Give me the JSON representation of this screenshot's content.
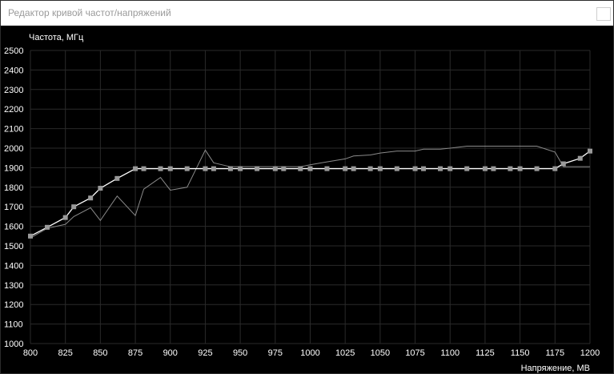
{
  "window": {
    "title": "Редактор кривой частот/напряжений",
    "close_label": ""
  },
  "chart_data": {
    "type": "line",
    "ylabel": "Частота, МГц",
    "xlabel": "Напряжение, МВ",
    "xlim": [
      800,
      1200
    ],
    "ylim": [
      1000,
      2500
    ],
    "x_ticks": [
      800,
      825,
      850,
      875,
      900,
      925,
      950,
      975,
      1000,
      1025,
      1050,
      1075,
      1100,
      1125,
      1150,
      1175,
      1200
    ],
    "y_ticks": [
      1000,
      1100,
      1200,
      1300,
      1400,
      1500,
      1600,
      1700,
      1800,
      1900,
      2000,
      2100,
      2200,
      2300,
      2400,
      2500
    ],
    "grid": true,
    "series": [
      {
        "color": "#ffffff",
        "marker": "square",
        "points": [
          [
            800,
            1550
          ],
          [
            812,
            1595
          ],
          [
            825,
            1645
          ],
          [
            831,
            1700
          ],
          [
            843,
            1745
          ],
          [
            850,
            1795
          ],
          [
            862,
            1845
          ],
          [
            875,
            1895
          ],
          [
            881,
            1895
          ],
          [
            893,
            1895
          ],
          [
            900,
            1895
          ],
          [
            912,
            1895
          ],
          [
            925,
            1895
          ],
          [
            931,
            1895
          ],
          [
            943,
            1895
          ],
          [
            950,
            1895
          ],
          [
            962,
            1895
          ],
          [
            975,
            1895
          ],
          [
            981,
            1895
          ],
          [
            993,
            1895
          ],
          [
            1000,
            1895
          ],
          [
            1012,
            1895
          ],
          [
            1025,
            1895
          ],
          [
            1031,
            1895
          ],
          [
            1043,
            1895
          ],
          [
            1050,
            1895
          ],
          [
            1062,
            1895
          ],
          [
            1075,
            1895
          ],
          [
            1081,
            1895
          ],
          [
            1093,
            1895
          ],
          [
            1100,
            1895
          ],
          [
            1112,
            1895
          ],
          [
            1125,
            1895
          ],
          [
            1131,
            1895
          ],
          [
            1143,
            1895
          ],
          [
            1150,
            1895
          ],
          [
            1162,
            1895
          ],
          [
            1175,
            1895
          ],
          [
            1181,
            1920
          ],
          [
            1193,
            1948
          ],
          [
            1200,
            1985
          ]
        ]
      },
      {
        "color": "#8a8a8a",
        "marker": "none",
        "points": [
          [
            800,
            1540
          ],
          [
            812,
            1590
          ],
          [
            825,
            1610
          ],
          [
            831,
            1650
          ],
          [
            843,
            1695
          ],
          [
            850,
            1630
          ],
          [
            862,
            1755
          ],
          [
            875,
            1655
          ],
          [
            881,
            1790
          ],
          [
            893,
            1850
          ],
          [
            900,
            1785
          ],
          [
            912,
            1800
          ],
          [
            925,
            1990
          ],
          [
            931,
            1925
          ],
          [
            943,
            1905
          ],
          [
            950,
            1905
          ],
          [
            962,
            1905
          ],
          [
            975,
            1905
          ],
          [
            981,
            1905
          ],
          [
            993,
            1905
          ],
          [
            1000,
            1915
          ],
          [
            1012,
            1930
          ],
          [
            1025,
            1945
          ],
          [
            1031,
            1960
          ],
          [
            1043,
            1965
          ],
          [
            1050,
            1975
          ],
          [
            1062,
            1985
          ],
          [
            1075,
            1985
          ],
          [
            1081,
            1995
          ],
          [
            1093,
            1995
          ],
          [
            1100,
            2000
          ],
          [
            1112,
            2010
          ],
          [
            1125,
            2010
          ],
          [
            1131,
            2010
          ],
          [
            1143,
            2010
          ],
          [
            1150,
            2010
          ],
          [
            1162,
            2010
          ],
          [
            1175,
            1980
          ],
          [
            1181,
            1905
          ],
          [
            1193,
            1905
          ],
          [
            1200,
            1905
          ]
        ]
      }
    ]
  }
}
